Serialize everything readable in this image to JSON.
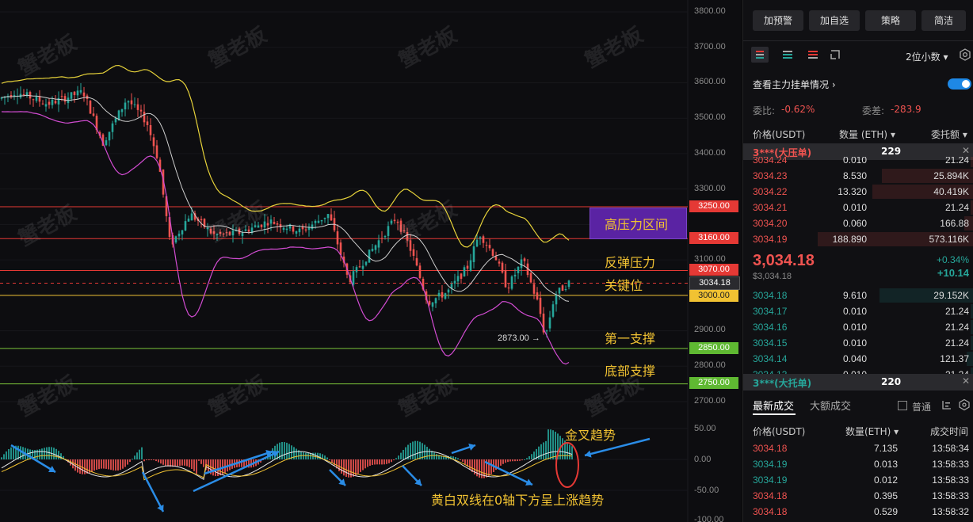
{
  "chart": {
    "y_axis_labels": [
      "3800.00",
      "3700.00",
      "3600.00",
      "3500.00",
      "3400.00",
      "3300.00",
      "3200.00",
      "3100.00",
      "3000.00",
      "2900.00",
      "2800.00",
      "2700.00"
    ],
    "macd_axis_labels": [
      "50.00",
      "0.00",
      "-50.00",
      "-100.00"
    ],
    "price_tags": {
      "p3250": "3250.00",
      "p3160": "3160.00",
      "p3070": "3070.00",
      "p3034": "3034.18",
      "p3000": "3000.00",
      "p2850": "2850.00",
      "p2750": "2750.00"
    },
    "low_marker": "2873.00 →",
    "annotations": {
      "high_pressure_zone": "高压力区间",
      "rebound_pressure": "反弹压力",
      "key_level": "关键位",
      "first_support": "第一支撑",
      "bottom_support": "底部支撑",
      "golden_cross": "金叉趋势",
      "dual_line_note": "黄白双线在0轴下方呈上涨趋势"
    },
    "watermark": "蟹老板",
    "colors": {
      "up": "#26a69a",
      "down": "#ef5350",
      "yellow": "#f1c232",
      "band_upper": "#e6d23a",
      "band_lower": "#d24cd2",
      "mid": "#cfcfcf",
      "red_line": "#e53935",
      "green_line": "#7cc43a",
      "zone": "#6a2bb3"
    }
  },
  "panel": {
    "buttons": [
      "加预警",
      "加自选",
      "策略",
      "简洁"
    ],
    "decimals": "2位小数",
    "toggle_label": "查看主力挂单情况",
    "ratio_label": "委比:",
    "ratio_value": "-0.62%",
    "diff_label": "委差:",
    "diff_value": "-283.9",
    "headers": {
      "price": "价格(USDT)",
      "qty": "数量 (ETH)",
      "amount": "委托额"
    },
    "big_sell": {
      "label": "3***(大压单)",
      "qty": "229"
    },
    "asks": [
      {
        "price": "3034.24",
        "qty": "0.010",
        "amt": "21.24"
      },
      {
        "price": "3034.23",
        "qty": "8.530",
        "amt": "25.894K"
      },
      {
        "price": "3034.22",
        "qty": "13.320",
        "amt": "40.419K"
      },
      {
        "price": "3034.21",
        "qty": "0.010",
        "amt": "21.24"
      },
      {
        "price": "3034.20",
        "qty": "0.060",
        "amt": "166.88"
      },
      {
        "price": "3034.19",
        "qty": "188.890",
        "amt": "573.116K"
      }
    ],
    "last_price": "3,034.18",
    "last_price_usd": "$3,034.18",
    "change_pct": "+0.34%",
    "change_abs": "+10.14",
    "bids": [
      {
        "price": "3034.18",
        "qty": "9.610",
        "amt": "29.152K"
      },
      {
        "price": "3034.17",
        "qty": "0.010",
        "amt": "21.24"
      },
      {
        "price": "3034.16",
        "qty": "0.010",
        "amt": "21.24"
      },
      {
        "price": "3034.15",
        "qty": "0.010",
        "amt": "21.24"
      },
      {
        "price": "3034.14",
        "qty": "0.040",
        "amt": "121.37"
      },
      {
        "price": "3034.13",
        "qty": "0.010",
        "amt": "21.24"
      }
    ],
    "big_buy": {
      "label": "3***(大托单)",
      "qty": "220"
    },
    "trade_tabs": {
      "latest": "最新成交",
      "large": "大额成交",
      "normal": "普通"
    },
    "trade_headers": {
      "price": "价格(USDT)",
      "qty": "数量(ETH)",
      "time": "成交时间"
    },
    "trades": [
      {
        "price": "3034.18",
        "qty": "7.135",
        "time": "13:58:34",
        "side": "down"
      },
      {
        "price": "3034.19",
        "qty": "0.013",
        "time": "13:58:33",
        "side": "up"
      },
      {
        "price": "3034.19",
        "qty": "0.012",
        "time": "13:58:33",
        "side": "up"
      },
      {
        "price": "3034.18",
        "qty": "0.395",
        "time": "13:58:33",
        "side": "down"
      },
      {
        "price": "3034.18",
        "qty": "0.529",
        "time": "13:58:32",
        "side": "down"
      }
    ]
  }
}
